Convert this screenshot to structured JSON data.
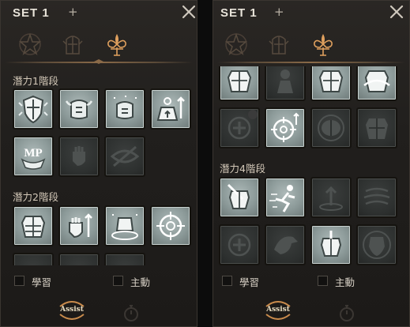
{
  "colors": {
    "accent": "#e3a35a",
    "tile_active": "#9ba8a7",
    "tile_dim": "#2f3231",
    "text": "#d3c8b8"
  },
  "panels": [
    {
      "set_label": "SET 1",
      "add_tab": "+",
      "header_icons": [
        "star-emblem-icon",
        "knight-emblem-icon",
        "fleur-emblem-icon"
      ],
      "sections": [
        {
          "title": "潛力1階段",
          "tiles": [
            {
              "icon": "shield-icon",
              "active": true
            },
            {
              "icon": "armor-up-icon",
              "active": true
            },
            {
              "icon": "armor-stars-icon",
              "active": true
            },
            {
              "icon": "weight-up-icon",
              "active": true
            },
            {
              "icon": "mp-up-icon",
              "active": true,
              "text": "MP"
            },
            {
              "icon": "fist-icon",
              "active": false
            },
            {
              "icon": "eye-slash-icon",
              "active": false
            }
          ]
        },
        {
          "title": "潛力2階段",
          "tiles": [
            {
              "icon": "chest-armor-icon",
              "active": true
            },
            {
              "icon": "fist-up-icon",
              "active": true
            },
            {
              "icon": "armor-platform-icon",
              "active": true
            },
            {
              "icon": "crosshair-icon",
              "active": true
            }
          ]
        }
      ],
      "checkboxes": [
        {
          "label": "學習",
          "checked": false
        },
        {
          "label": "主動",
          "checked": false
        }
      ],
      "assist_label": "Assist"
    },
    {
      "set_label": "SET 1",
      "add_tab": "+",
      "header_icons": [
        "star-emblem-icon",
        "knight-emblem-icon",
        "fleur-emblem-icon"
      ],
      "sections": [
        {
          "title": "",
          "tiles": [
            {
              "icon": "chest-armor-icon",
              "active": true
            },
            {
              "icon": "figure-icon",
              "active": false
            },
            {
              "icon": "chest-armor-icon",
              "active": true
            },
            {
              "icon": "armor-swirl-icon",
              "active": true
            },
            {
              "icon": "heal-plus-icon",
              "active": false
            },
            {
              "icon": "crosshair-up-icon",
              "active": true
            },
            {
              "icon": "brain-icon",
              "active": false
            },
            {
              "icon": "chest-armor-icon",
              "active": false
            }
          ]
        },
        {
          "title": "潛力4階段",
          "tiles": [
            {
              "icon": "armor-sword-icon",
              "active": true
            },
            {
              "icon": "dash-icon",
              "active": true
            },
            {
              "icon": "arrow-up-ring-icon",
              "active": false
            },
            {
              "icon": "swirl-shield-icon",
              "active": false
            },
            {
              "icon": "heal-plus-icon",
              "active": false
            },
            {
              "icon": "eagle-icon",
              "active": false
            },
            {
              "icon": "armor-sword-icon",
              "active": true
            },
            {
              "icon": "orbit-shield-icon",
              "active": false
            }
          ]
        }
      ],
      "checkboxes": [
        {
          "label": "學習",
          "checked": false
        },
        {
          "label": "主動",
          "checked": false
        }
      ],
      "assist_label": "Assist"
    }
  ]
}
